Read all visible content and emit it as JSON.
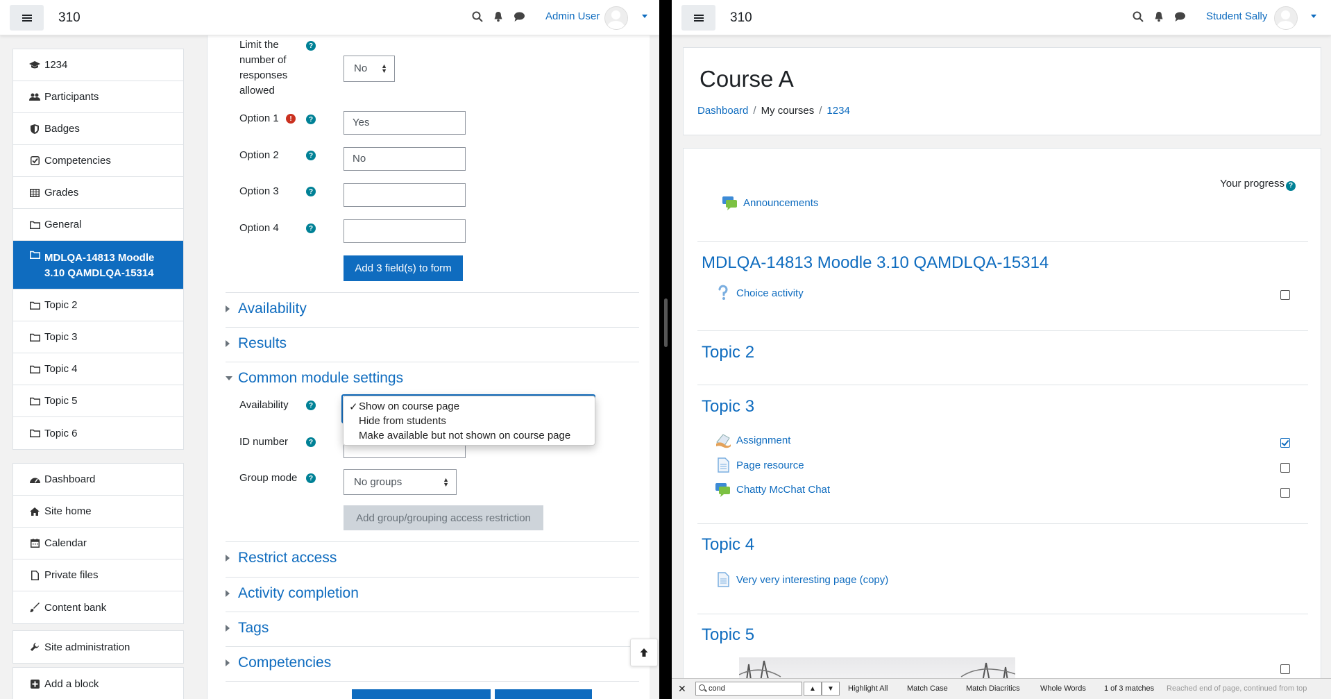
{
  "left": {
    "brand": "310",
    "user_name": "Admin User",
    "drawer": {
      "course_items": [
        {
          "label": "1234",
          "icon": "graduation-cap-icon"
        },
        {
          "label": "Participants",
          "icon": "users-icon"
        },
        {
          "label": "Badges",
          "icon": "shield-icon"
        },
        {
          "label": "Competencies",
          "icon": "check-square-icon"
        },
        {
          "label": "Grades",
          "icon": "table-icon"
        },
        {
          "label": "General",
          "icon": "folder-icon"
        },
        {
          "label": "MDLQA-14813 Moodle 3.10 QAMDLQA-15314",
          "icon": "folder-icon"
        },
        {
          "label": "Topic 2",
          "icon": "folder-icon"
        },
        {
          "label": "Topic 3",
          "icon": "folder-icon"
        },
        {
          "label": "Topic 4",
          "icon": "folder-icon"
        },
        {
          "label": "Topic 5",
          "icon": "folder-icon"
        },
        {
          "label": "Topic 6",
          "icon": "folder-icon"
        }
      ],
      "site_items": [
        {
          "label": "Dashboard",
          "icon": "tachometer-icon"
        },
        {
          "label": "Site home",
          "icon": "home-icon"
        },
        {
          "label": "Calendar",
          "icon": "calendar-icon"
        },
        {
          "label": "Private files",
          "icon": "file-icon"
        },
        {
          "label": "Content bank",
          "icon": "paint-brush-icon"
        }
      ],
      "site_admin": "Site administration",
      "add_block": "Add a block"
    },
    "form": {
      "limit_label": "Limit the number of responses allowed",
      "limit_value": "No",
      "option1_label": "Option 1",
      "option1_value": "Yes",
      "option2_label": "Option 2",
      "option2_value": "No",
      "option3_label": "Option 3",
      "option3_value": "",
      "option4_label": "Option 4",
      "option4_value": "",
      "add_fields_button": "Add 3 field(s) to form",
      "sections": [
        "Availability",
        "Results",
        "Common module settings",
        "Restrict access",
        "Activity completion",
        "Tags",
        "Competencies"
      ],
      "availability_label": "Availability",
      "availability_options": [
        "Show on course page",
        "Hide from students",
        "Make available but not shown on course page"
      ],
      "availability_selected": "✓",
      "idnumber_label": "ID number",
      "groupmode_label": "Group mode",
      "groupmode_value": "No groups",
      "add_group_restriction": "Add group/grouping access restriction"
    }
  },
  "right": {
    "brand": "310",
    "user_name": "Student Sally",
    "course_title": "Course A",
    "breadcrumb": [
      "Dashboard",
      "My courses",
      "1234"
    ],
    "progress_label": "Your progress",
    "announcements": "Announcements",
    "sections": [
      {
        "title": "MDLQA-14813 Moodle 3.10 QAMDLQA-15314",
        "activities": [
          {
            "name": "Choice activity",
            "icon": "question-icon",
            "done": false
          }
        ]
      },
      {
        "title": "Topic 2",
        "activities": []
      },
      {
        "title": "Topic 3",
        "activities": [
          {
            "name": "Assignment",
            "icon": "assignment-icon",
            "done": true
          },
          {
            "name": "Page resource",
            "icon": "page-icon",
            "done": false
          },
          {
            "name": "Chatty McChat Chat",
            "icon": "chat-icon",
            "done": false
          }
        ]
      },
      {
        "title": "Topic 4",
        "activities": [
          {
            "name": "Very very interesting page (copy)",
            "icon": "page-icon"
          }
        ]
      },
      {
        "title": "Topic 5",
        "activities": []
      }
    ],
    "findbar": {
      "query": "cond",
      "highlight_all": "Highlight All",
      "match_case": "Match Case",
      "match_diacritics": "Match Diacritics",
      "whole_words": "Whole Words",
      "matches": "1 of 3 matches",
      "status": "Reached end of page, continued from top"
    }
  },
  "colors": {
    "brand_blue": "#0f6cbf",
    "help_teal": "#008196",
    "required_red": "#ca3120"
  }
}
